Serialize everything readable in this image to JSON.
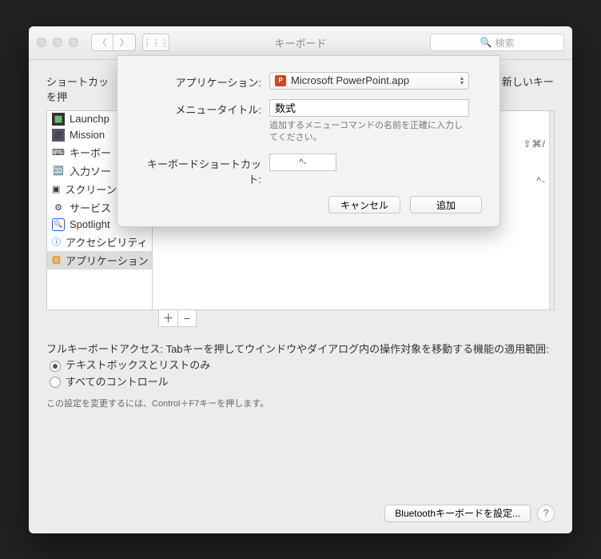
{
  "window": {
    "title": "キーボード",
    "search_placeholder": "検索"
  },
  "main": {
    "intro_prefix": "ショートカッ",
    "intro_suffix": "してから、新しいキーを押",
    "sidebar": {
      "items": [
        {
          "label": "Launchp",
          "icon": "🚀"
        },
        {
          "label": "Mission",
          "icon": "🖥"
        },
        {
          "label": "キーボー",
          "icon": "⌨"
        },
        {
          "label": "入力ソー",
          "icon": "🈶"
        },
        {
          "label": "スクリーンショット",
          "icon": "🖼"
        },
        {
          "label": "サービス",
          "icon": "⚙"
        },
        {
          "label": "Spotlight",
          "icon": "🔍"
        },
        {
          "label": "アクセシビリティ",
          "icon": "ⓘ"
        },
        {
          "label": "アプリケーション",
          "icon": "🔶"
        }
      ]
    },
    "right_rows": [
      {
        "label": "",
        "kbd": "⇧⌘/"
      },
      {
        "label": "",
        "kbd": "^-"
      }
    ],
    "fk_label": "フルキーボードアクセス: Tabキーを押してウインドウやダイアログ内の操作対象を移動する機能の適用範囲:",
    "radio1": "テキストボックスとリストのみ",
    "radio2": "すべてのコントロール",
    "hint": "この設定を変更するには、Control＋F7キーを押します。",
    "bluetooth_btn": "Bluetoothキーボードを設定..."
  },
  "sheet": {
    "app_label": "アプリケーション:",
    "app_value": "Microsoft PowerPoint.app",
    "menu_label": "メニュータイトル:",
    "menu_value": "数式",
    "menu_helper": "追加するメニューコマンドの名前を正確に入力してください。",
    "shortcut_label": "キーボードショートカット:",
    "shortcut_value": "^-",
    "cancel": "キャンセル",
    "add": "追加"
  },
  "buttons": {
    "plus": "＋",
    "minus": "−"
  }
}
